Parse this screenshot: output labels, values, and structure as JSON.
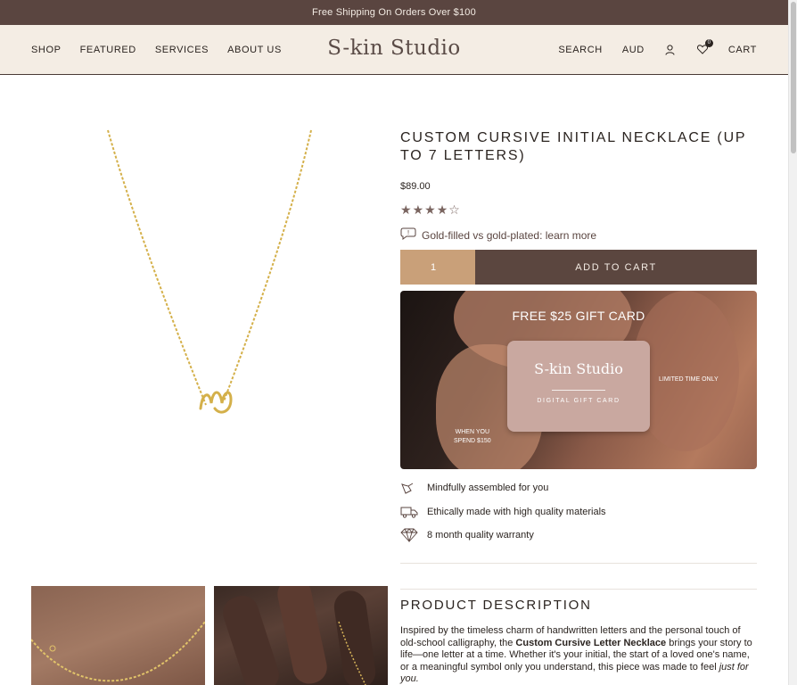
{
  "announcement": "Free Shipping On Orders Over $100",
  "header": {
    "nav_left": [
      "SHOP",
      "FEATURED",
      "SERVICES",
      "ABOUT US"
    ],
    "logo": "S-kin Studio",
    "search": "SEARCH",
    "currency": "AUD",
    "wishlist_count": "0",
    "cart": "CART"
  },
  "product": {
    "title": "CUSTOM CURSIVE INITIAL NECKLACE (UP TO 7 LETTERS)",
    "price": "$89.00",
    "rating": 4,
    "rating_max": 5,
    "learn_more": "Gold-filled vs gold-plated: learn more",
    "quantity": "1",
    "add_to_cart": "ADD TO CART"
  },
  "promo": {
    "headline": "FREE $25 GIFT CARD",
    "card_logo": "S-kin Studio",
    "card_sub": "DIGITAL GIFT CARD",
    "limited": "LIMITED TIME ONLY",
    "spend_line1": "WHEN YOU",
    "spend_line2": "SPEND $150"
  },
  "features": [
    {
      "icon": "hand-icon",
      "text": "Mindfully assembled for you"
    },
    {
      "icon": "truck-icon",
      "text": "Ethically made with high quality materials"
    },
    {
      "icon": "diamond-icon",
      "text": "8 month quality warranty"
    }
  ],
  "description": {
    "title": "PRODUCT DESCRIPTION",
    "text_before": "Inspired by the timeless charm of handwritten letters and the personal touch of old-school calligraphy, the ",
    "bold": "Custom Cursive Letter Necklace",
    "text_middle": " brings your story to life—one letter at a time. Whether it's your initial, the start of a loved one's name, or a meaningful symbol only you understand, this piece was made to feel ",
    "italic": "just for you."
  },
  "colors": {
    "announcement_bg": "#5a4540",
    "header_bg": "#f4ede4",
    "qty_bg": "#c9a079",
    "add_to_cart_bg": "#5b463f",
    "gold": "#d4b04a"
  }
}
